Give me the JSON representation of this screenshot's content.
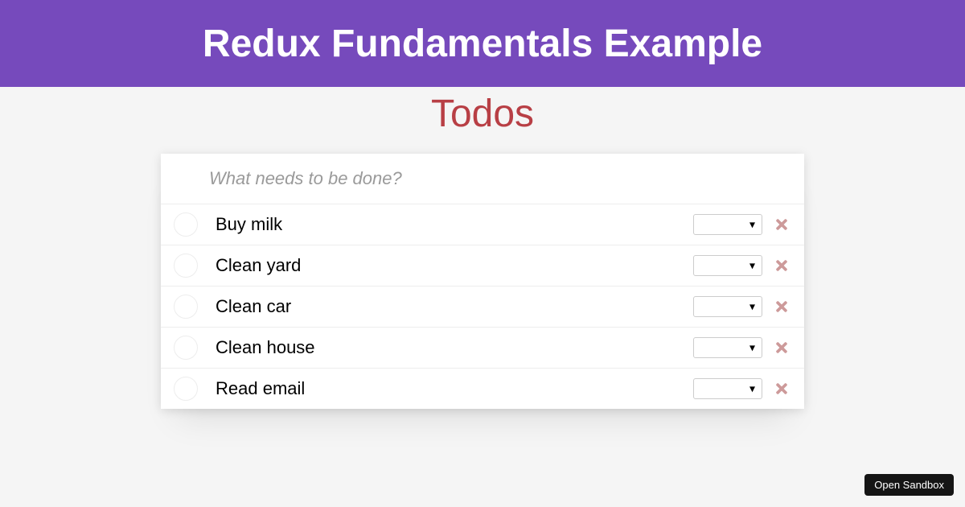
{
  "header": {
    "title": "Redux Fundamentals Example"
  },
  "section": {
    "title": "Todos"
  },
  "input": {
    "placeholder": "What needs to be done?"
  },
  "todos": [
    {
      "text": "Buy milk"
    },
    {
      "text": "Clean yard"
    },
    {
      "text": "Clean car"
    },
    {
      "text": "Clean house"
    },
    {
      "text": "Read email"
    }
  ],
  "footer": {
    "open_sandbox": "Open Sandbox"
  }
}
